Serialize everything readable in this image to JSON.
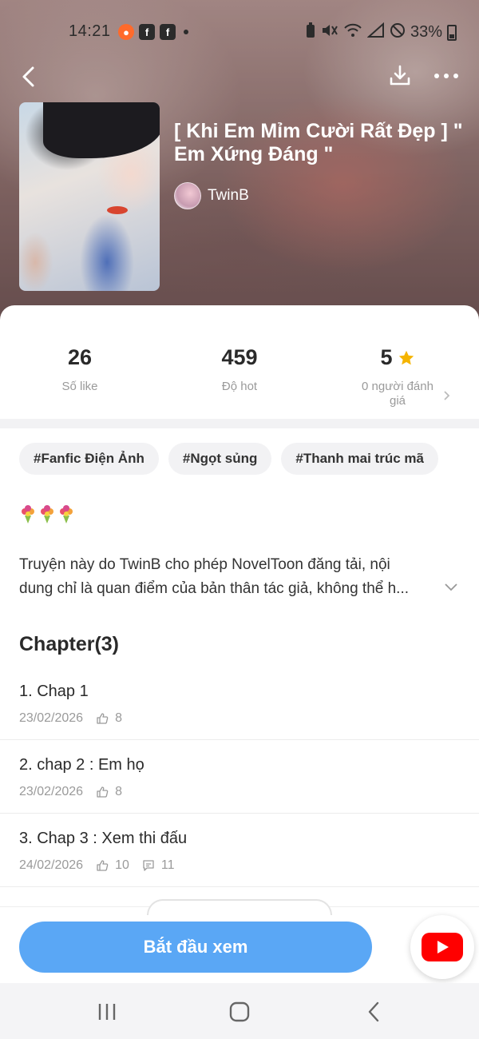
{
  "status_bar": {
    "time": "14:21",
    "battery": "33%",
    "icons": [
      "screen-record-icon",
      "facebook-icon",
      "facebook-icon",
      "dot-icon",
      "battery-saver-icon",
      "mute-icon",
      "wifi-icon",
      "signal-icon",
      "dnd-icon",
      "battery-icon"
    ]
  },
  "header": {
    "back_icon": "chevron-left-icon",
    "download_icon": "download-icon",
    "more_icon": "more-horizontal-icon"
  },
  "story": {
    "title": "[ Khi Em Mỉm Cười Rất Đẹp ] \" Em Xứng Đáng \"",
    "author": "TwinB"
  },
  "stats": {
    "likes": {
      "value": "26",
      "label": "Số like"
    },
    "hot": {
      "value": "459",
      "label": "Độ hot"
    },
    "rating": {
      "value": "5",
      "label": "0 người đánh giá",
      "star_color": "#f5b400"
    }
  },
  "tags": [
    "#Fanfic Điện Ảnh",
    "#Ngọt sủng",
    "#Thanh mai trúc mã"
  ],
  "description": {
    "line1": "Truyện này do TwinB  cho phép NovelToon đăng tải, nội",
    "line2": "dung chỉ là quan điểm của bản thân tác giả, không thể h..."
  },
  "chapters": {
    "heading": "Chapter(3)",
    "items": [
      {
        "title": "1. Chap 1",
        "date": "23/02/2026",
        "likes": "8",
        "comments": ""
      },
      {
        "title": "2. chap 2 : Em họ",
        "date": "23/02/2026",
        "likes": "8",
        "comments": ""
      },
      {
        "title": "3. Chap 3 : Xem thi đấu",
        "date": "24/02/2026",
        "likes": "10",
        "comments": "11"
      }
    ]
  },
  "actions": {
    "start_label": "Bắt đầu xem",
    "start_color": "#5aa7f5"
  },
  "colors": {
    "youtube_red": "#ff0000",
    "accent_blue": "#5aa7f5"
  }
}
